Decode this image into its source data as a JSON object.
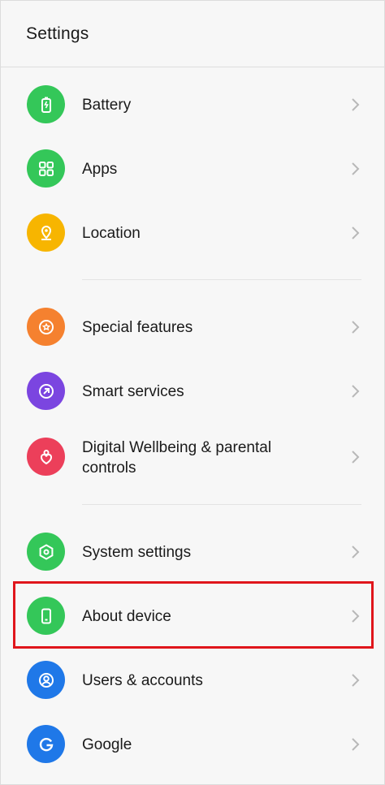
{
  "header": {
    "title": "Settings"
  },
  "colors": {
    "green": "#34c759",
    "yellow": "#f7b500",
    "orange": "#f5812f",
    "purple": "#7b45e0",
    "red": "#ec3f5a",
    "blue": "#1f78e8",
    "highlight": "#e0161c"
  },
  "items": [
    {
      "label": "Battery",
      "icon": "battery-icon",
      "color": "#34c759"
    },
    {
      "label": "Apps",
      "icon": "apps-grid-icon",
      "color": "#34c759"
    },
    {
      "label": "Location",
      "icon": "location-icon",
      "color": "#f7b500"
    },
    {
      "label": "Special features",
      "icon": "star-icon",
      "color": "#f5812f"
    },
    {
      "label": "Smart services",
      "icon": "smart-services-icon",
      "color": "#7b45e0"
    },
    {
      "label": "Digital Wellbeing & parental controls",
      "icon": "wellbeing-icon",
      "color": "#ec3f5a"
    },
    {
      "label": "System settings",
      "icon": "hexagon-icon",
      "color": "#34c759"
    },
    {
      "label": "About device",
      "icon": "phone-icon",
      "color": "#34c759"
    },
    {
      "label": "Users & accounts",
      "icon": "user-icon",
      "color": "#1f78e8"
    },
    {
      "label": "Google",
      "icon": "google-icon",
      "color": "#1f78e8"
    }
  ]
}
